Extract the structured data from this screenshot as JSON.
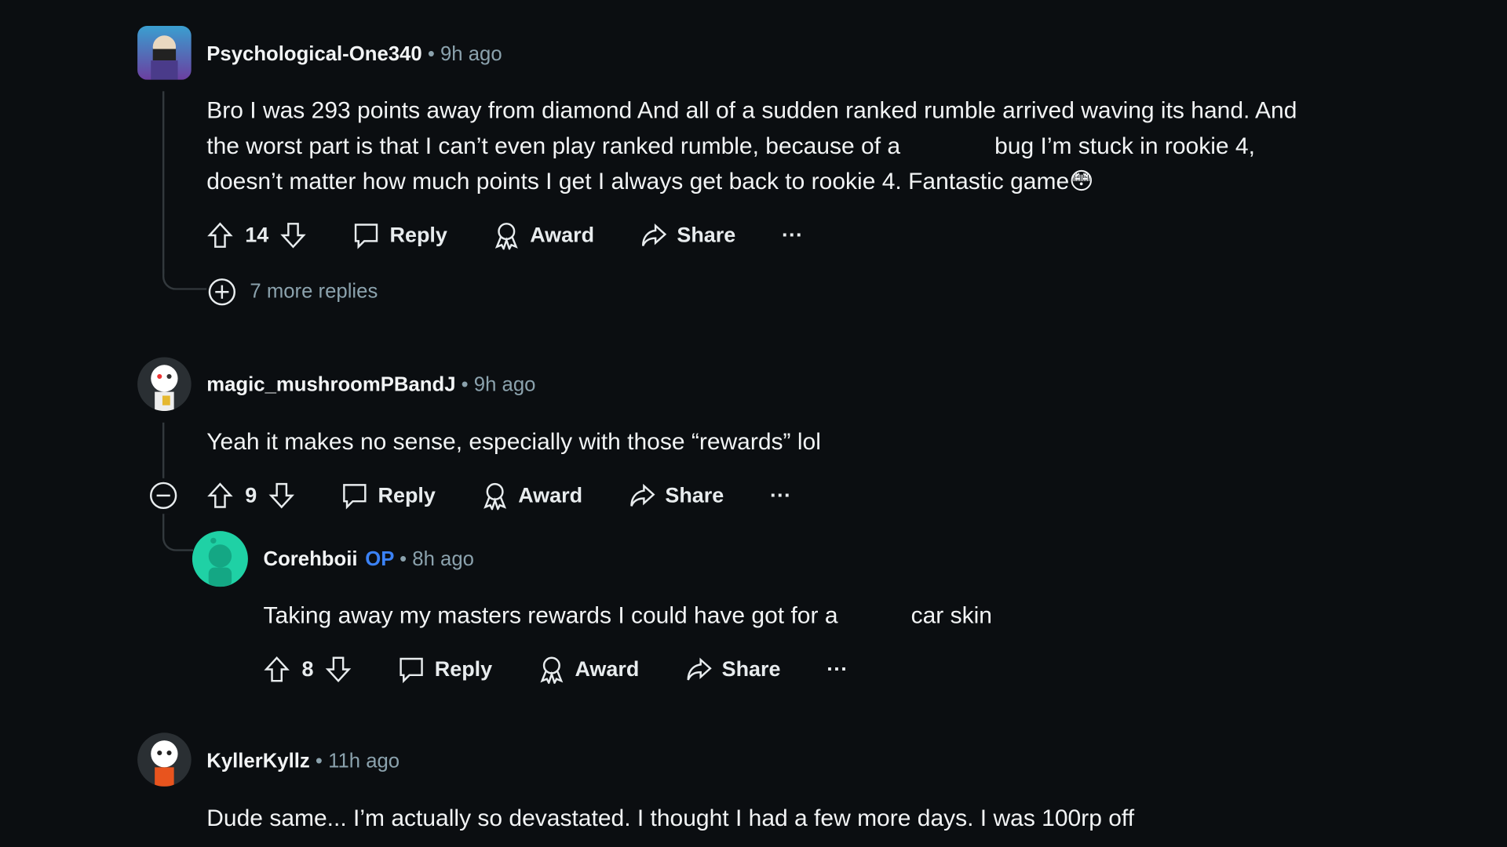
{
  "colors": {
    "background": "#0b0e11",
    "text": "#f2f4f5",
    "meta": "#8ba2ad",
    "op": "#3b82f6"
  },
  "comments": [
    {
      "user": "Psychological-One340",
      "time": "• 9h ago",
      "lines": [
        "Bro I was 293 points away from diamond And all of a sudden ranked rumble arrived waving its hand. And",
        "the worst part is that I can’t even play ranked rumble, because of a",
        "bug I’m stuck in rookie 4,",
        "doesn’t matter how much points I get I always get back to rookie 4. Fantastic game",
        "😳"
      ],
      "votes": "14",
      "more_replies": "7 more replies"
    },
    {
      "user": "magic_mushroomPBandJ",
      "time": "• 9h ago",
      "lines": [
        "Yeah it makes no sense, especially with those “rewards” lol"
      ],
      "votes": "9"
    },
    {
      "user": "Corehboii",
      "badge": "OP",
      "time": "• 8h ago",
      "lines": [
        "Taking away my masters rewards I could have got for a",
        "car skin"
      ],
      "votes": "8"
    },
    {
      "user": "KyllerKyllz",
      "time": "• 11h ago",
      "lines": [
        "Dude same... I’m actually so devastated. I thought I had a few more days. I was 100rp off"
      ]
    }
  ],
  "actions": {
    "reply": "Reply",
    "award": "Award",
    "share": "Share",
    "more": "···"
  }
}
